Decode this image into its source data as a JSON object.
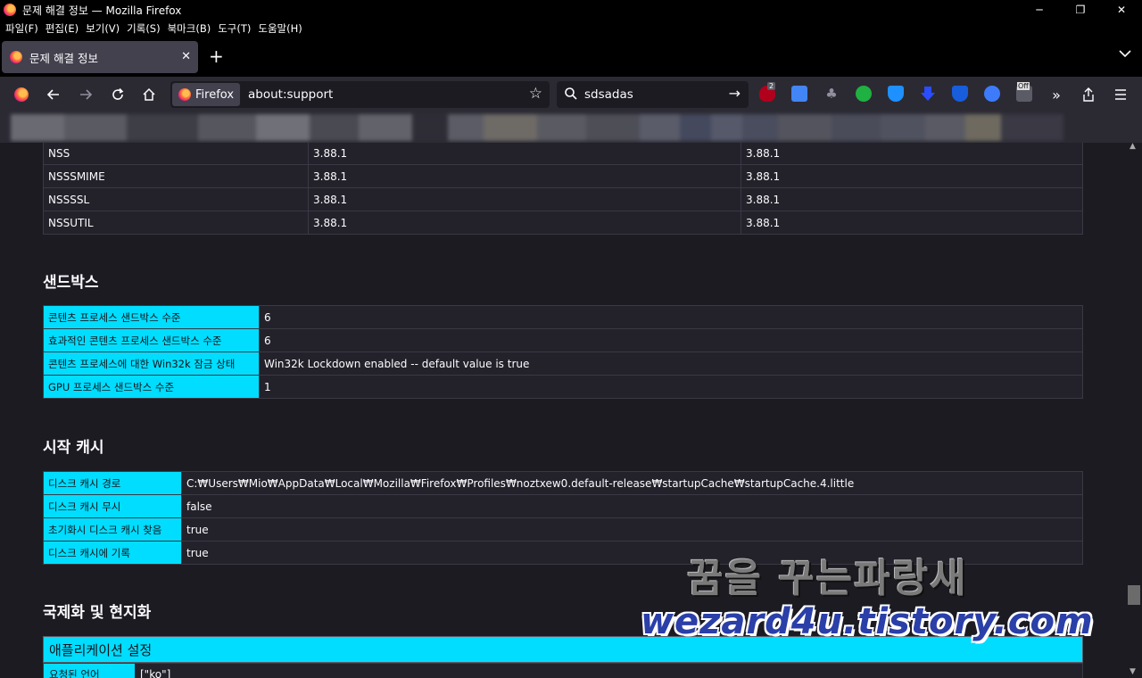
{
  "window": {
    "title": "문제 해결 정보 — Mozilla Firefox",
    "controls": [
      "─",
      "❐",
      "✕"
    ]
  },
  "menu": [
    "파일(F)",
    "편집(E)",
    "보기(V)",
    "기록(S)",
    "북마크(B)",
    "도구(T)",
    "도움말(H)"
  ],
  "tab": {
    "label": "문제 해결 정보",
    "close": "✕",
    "new_tab": "+"
  },
  "navbar": {
    "identity_label": "Firefox",
    "url": "about:support",
    "search_value": "sdsadas",
    "ext_badge": "2",
    "ext_off": "Off"
  },
  "library_versions": {
    "rows": [
      {
        "name": "NSS",
        "expected": "3.88.1",
        "used": "3.88.1"
      },
      {
        "name": "NSSSMIME",
        "expected": "3.88.1",
        "used": "3.88.1"
      },
      {
        "name": "NSSSSL",
        "expected": "3.88.1",
        "used": "3.88.1"
      },
      {
        "name": "NSSUTIL",
        "expected": "3.88.1",
        "used": "3.88.1"
      }
    ]
  },
  "sandbox": {
    "heading": "샌드박스",
    "rows": [
      {
        "key": "콘텐츠 프로세스 샌드박스 수준",
        "value": "6"
      },
      {
        "key": "효과적인 콘텐츠 프로세스 샌드박스 수준",
        "value": "6"
      },
      {
        "key": "콘텐츠 프로세스에 대한 Win32k 잠금 상태",
        "value": "Win32k Lockdown enabled -- default value is true"
      },
      {
        "key": "GPU 프로세스 샌드박스 수준",
        "value": "1"
      }
    ]
  },
  "startup_cache": {
    "heading": "시작 캐시",
    "rows": [
      {
        "key": "디스크 캐시 경로",
        "value": "C:₩Users₩Mio₩AppData₩Local₩Mozilla₩Firefox₩Profiles₩noztxew0.default-release₩startupCache₩startupCache.4.little"
      },
      {
        "key": "디스크 캐시 무시",
        "value": "false"
      },
      {
        "key": "초기화시 디스크 캐시 찾음",
        "value": "true"
      },
      {
        "key": "디스크 캐시에 기록",
        "value": "true"
      }
    ]
  },
  "i18n": {
    "heading": "국제화 및 현지화",
    "app_settings": "애플리케이션 설정",
    "requested_locales_key": "요청된 언어",
    "requested_locales_value": "[\"ko\"]"
  },
  "watermark": {
    "line1": "꿈을 꾸는파랑새",
    "line2": "wezard4u.tistory.com"
  },
  "colors": {
    "key_cell": "#00ddff",
    "page_bg": "#1c1b22",
    "toolbar_bg": "#2b2a33",
    "titlebar_bg": "#000000"
  }
}
